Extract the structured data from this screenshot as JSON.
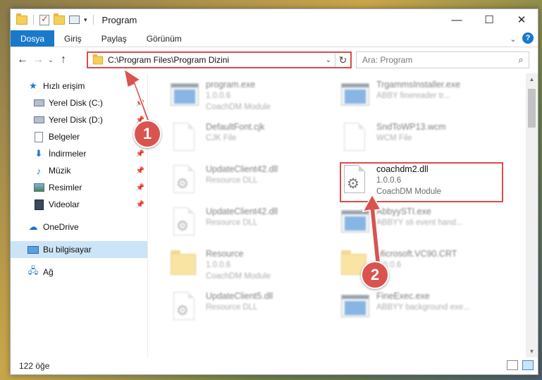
{
  "window": {
    "title": "Program",
    "controls": {
      "minimize": "—",
      "maximize": "☐",
      "close": "✕"
    }
  },
  "ribbon": {
    "tabs": [
      {
        "label": "Dosya",
        "active": true
      },
      {
        "label": "Giriş",
        "active": false
      },
      {
        "label": "Paylaş",
        "active": false
      },
      {
        "label": "Görünüm",
        "active": false
      }
    ],
    "expand_icon": "chevron-down-icon",
    "help_label": "?"
  },
  "nav": {
    "back": "←",
    "forward": "→",
    "recent": "⌄",
    "up": "↑",
    "address": "C:\\Program Files\\Program Dizini",
    "refresh": "↻",
    "search_placeholder": "Ara: Program"
  },
  "sidebar": {
    "items": [
      {
        "label": "Hızlı erişim",
        "icon": "star-icon",
        "pinned": false
      },
      {
        "label": "Yerel Disk (C:)",
        "icon": "drive-icon",
        "pinned": true
      },
      {
        "label": "Yerel Disk (D:)",
        "icon": "drive-icon",
        "pinned": true
      },
      {
        "label": "Belgeler",
        "icon": "document-icon",
        "pinned": true
      },
      {
        "label": "İndirmeler",
        "icon": "download-icon",
        "pinned": true
      },
      {
        "label": "Müzik",
        "icon": "music-icon",
        "pinned": true
      },
      {
        "label": "Resimler",
        "icon": "pictures-icon",
        "pinned": true
      },
      {
        "label": "Videolar",
        "icon": "videos-icon",
        "pinned": true
      },
      {
        "label": "OneDrive",
        "icon": "cloud-icon",
        "pinned": false
      },
      {
        "label": "Bu bilgisayar",
        "icon": "computer-icon",
        "pinned": false,
        "selected": true
      },
      {
        "label": "Ağ",
        "icon": "network-icon",
        "pinned": false
      }
    ]
  },
  "files": {
    "left": [
      {
        "name": "program.exe",
        "line2": "1.0.0.6",
        "line3": "CoachDM Module",
        "icon": "exe-icon"
      },
      {
        "name": "DefaultFont.cjk",
        "line2": "CJK File",
        "line3": "",
        "icon": "file-icon"
      },
      {
        "name": "UpdateClient42.dll",
        "line2": "Resource DLL",
        "line3": "",
        "icon": "dll-icon"
      },
      {
        "name": "UpdateClient42.dll",
        "line2": "Resource DLL",
        "line3": "",
        "icon": "dll-icon"
      },
      {
        "name": "Resource",
        "line2": "1.0.0.6",
        "line3": "CoachDM Module",
        "icon": "folder-icon"
      },
      {
        "name": "UpdateClient5.dll",
        "line2": "Resource DLL",
        "line3": "",
        "icon": "dll-icon"
      }
    ],
    "right": [
      {
        "name": "TrgammsInstaller.exe",
        "line2": "ABBY finereader tr...",
        "line3": "",
        "icon": "exe-icon"
      },
      {
        "name": "SndToWP13.wcm",
        "line2": "WCM File",
        "line3": "",
        "icon": "file-icon"
      },
      {
        "name": "coachdm2.dll",
        "line2": "1.0.0.6",
        "line3": "CoachDM Module",
        "icon": "dll-icon",
        "highlighted": true
      },
      {
        "name": "AbbyySTI.exe",
        "line2": "ABBYY sti event hand...",
        "line3": "",
        "icon": "exe-icon"
      },
      {
        "name": "Microsoft.VC90.CRT",
        "line2": "1.0.0.6",
        "line3": "",
        "icon": "folder-icon"
      },
      {
        "name": "FineExec.exe",
        "line2": "ABBYY background exe...",
        "line3": "",
        "icon": "exe-icon"
      }
    ]
  },
  "status": {
    "count": "122 öğe"
  },
  "annotations": {
    "step1": "1",
    "step2": "2",
    "color": "#d9534f"
  }
}
